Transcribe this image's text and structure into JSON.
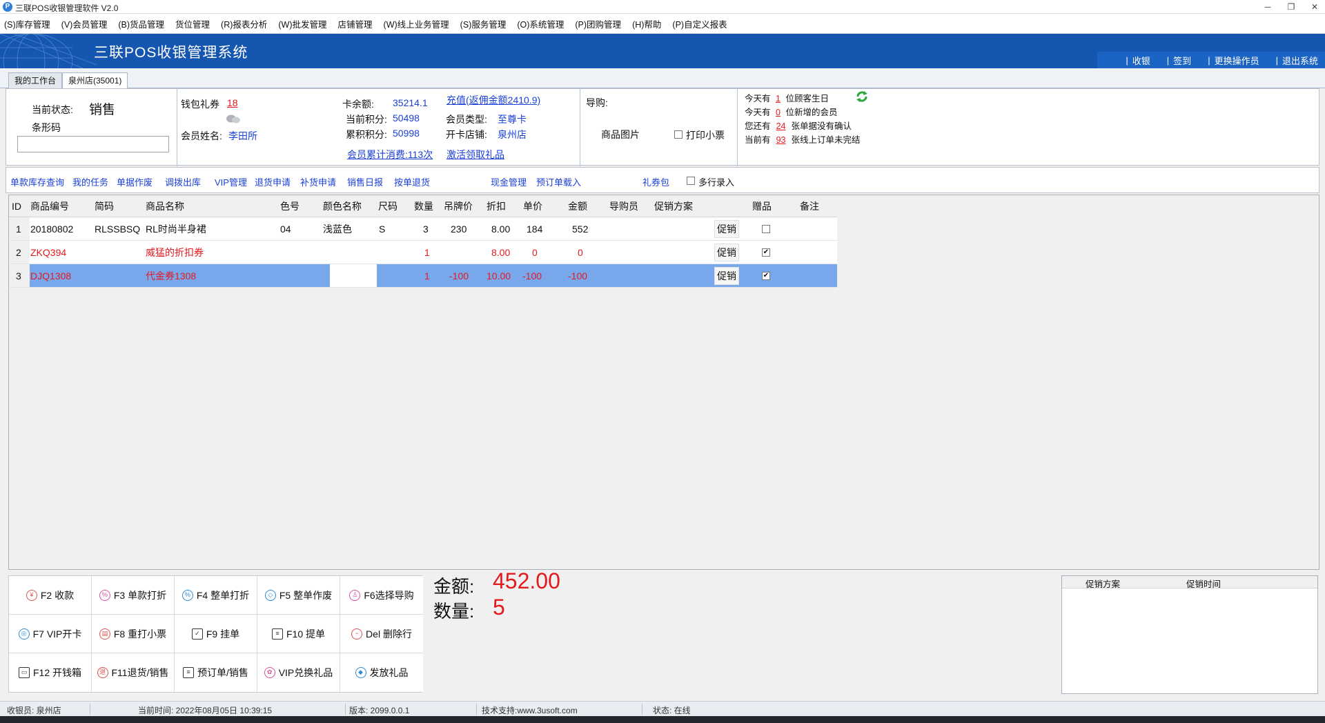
{
  "window": {
    "title": "三联POS收银管理软件 V2.0",
    "app_icon": "P",
    "minimize": "─",
    "restore": "❐",
    "close": "✕"
  },
  "menu": [
    "(S)库存管理",
    "(V)会员管理",
    "(B)货品管理",
    "货位管理",
    "(R)报表分析",
    "(W)批发管理",
    "店铺管理",
    "(W)线上业务管理",
    "(S)服务管理",
    "(O)系统管理",
    "(P)团购管理",
    "(H)帮助",
    "(P)自定义报表"
  ],
  "banner": {
    "title": "三联POS收银管理系统",
    "actions": [
      "收银",
      "签到",
      "更换操作员",
      "退出系统"
    ]
  },
  "tabs": [
    "我的工作台",
    "泉州店(35001)"
  ],
  "status_panel": {
    "state_label": "当前状态:",
    "state_value": "销售",
    "barcode_label": "条形码",
    "barcode_value": ""
  },
  "member": {
    "wallet_label": "钱包礼券",
    "wallet_value": "18",
    "name_label": "会员姓名:",
    "name_value": "李田所",
    "card_balance_label": "卡余额:",
    "card_balance_value": "35214.1",
    "recharge_link": "充值(返佣金额2410.9)",
    "points_label": "当前积分:",
    "points_value": "50498",
    "acc_points_label": "累积积分:",
    "acc_points_value": "50998",
    "type_label": "会员类型:",
    "type_value": "至尊卡",
    "store_label": "开卡店铺:",
    "store_value": "泉州店",
    "consume_link": "会员累计消费:113次",
    "gift_link": "激活领取礼品"
  },
  "guide": {
    "label": "导购:",
    "image_label": "商品图片",
    "print_label": "打印小票"
  },
  "notices": [
    {
      "prefix": "今天有",
      "value": "1",
      "suffix": "位顾客生日"
    },
    {
      "prefix": "今天有",
      "value": "0",
      "suffix": "位新增的会员"
    },
    {
      "prefix": "您还有",
      "value": "24",
      "suffix": "张单据没有确认"
    },
    {
      "prefix": "当前有",
      "value": "93",
      "suffix": "张线上订单未完结"
    }
  ],
  "func_links": [
    "单款库存查询",
    "我的任务",
    "单据作废",
    "调拨出库",
    "VIP管理",
    "退货申请",
    "补货申请",
    "销售日报",
    "按单退货",
    "现金管理",
    "预订单载入",
    "礼券包"
  ],
  "multi_row_label": "多行录入",
  "grid": {
    "columns": [
      "ID",
      "商品编号",
      "简码",
      "商品名称",
      "色号",
      "颜色名称",
      "尺码",
      "数量",
      "吊牌价",
      "折扣",
      "单价",
      "金额",
      "导购员",
      "促销方案",
      "赠品",
      "备注"
    ],
    "rows": [
      {
        "id": "1",
        "code": "20180802",
        "short": "RLSSBSQ",
        "name": "RL时尚半身裙",
        "color_no": "04",
        "color_name": "浅蓝色",
        "size": "S",
        "qty": "3",
        "tag_price": "230",
        "discount": "8.00",
        "unit_price": "184",
        "amount": "552",
        "promo": "促销",
        "gift": false
      },
      {
        "id": "2",
        "code": "ZKQ394",
        "short": "",
        "name": "威猛的折扣券",
        "color_no": "",
        "color_name": "",
        "size": "",
        "qty": "1",
        "tag_price": "",
        "discount": "8.00",
        "unit_price": "0",
        "amount": "0",
        "promo": "促销",
        "gift": true
      },
      {
        "id": "3",
        "code": "DJQ1308",
        "short": "",
        "name": "代金券1308",
        "color_no": "",
        "color_name": "",
        "size": "",
        "qty": "1",
        "tag_price": "-100",
        "discount": "10.00",
        "unit_price": "-100",
        "amount": "-100",
        "promo": "促销",
        "gift": true
      }
    ]
  },
  "buttons": [
    {
      "label": "F2 收款",
      "icon": "yen-icon",
      "glyph": "¥"
    },
    {
      "label": "F3 单款打折",
      "icon": "percent-icon",
      "glyph": "%"
    },
    {
      "label": "F4 整单打折",
      "icon": "percent-icon",
      "glyph": "%"
    },
    {
      "label": "F5 整单作废",
      "icon": "eraser-icon",
      "glyph": "◇"
    },
    {
      "label": "F6选择导购",
      "icon": "person-icon",
      "glyph": "♙"
    },
    {
      "label": "F7 VIP开卡",
      "icon": "vip-icon",
      "glyph": "◎"
    },
    {
      "label": "F8 重打小票",
      "icon": "printer-icon",
      "glyph": "▤"
    },
    {
      "label": "F9 挂单",
      "icon": "clipboard-icon",
      "glyph": "✓"
    },
    {
      "label": "F10 提单",
      "icon": "document-icon",
      "glyph": "≡"
    },
    {
      "label": "Del 删除行",
      "icon": "minus-icon",
      "glyph": "−"
    },
    {
      "label": "F12 开钱箱",
      "icon": "cashbox-icon",
      "glyph": "▭"
    },
    {
      "label": "F11退货/销售",
      "icon": "return-icon",
      "glyph": "退"
    },
    {
      "label": "预订单/销售",
      "icon": "list-icon",
      "glyph": "≡"
    },
    {
      "label": "VIP兑换礼品",
      "icon": "gift-icon",
      "glyph": "✿"
    },
    {
      "label": "发放礼品",
      "icon": "ticket-icon",
      "glyph": "◆"
    }
  ],
  "totals": {
    "amount_label": "金额:",
    "amount_value": "452.00",
    "qty_label": "数量:",
    "qty_value": "5"
  },
  "promo_panel": {
    "col1": "促销方案",
    "col2": "促销时间"
  },
  "statusbar": {
    "cashier": "收银员: 泉州店",
    "time": "当前时间:  2022年08月05日 10:39:15",
    "version": "版本: 2099.0.0.1",
    "support": "技术支持:www.3usoft.com",
    "state": "状态: 在线"
  },
  "colors": {
    "banner": "#1556b0",
    "link": "#1a3fd6",
    "alert": "#e4191d",
    "selected_row": "#78a7ec"
  }
}
